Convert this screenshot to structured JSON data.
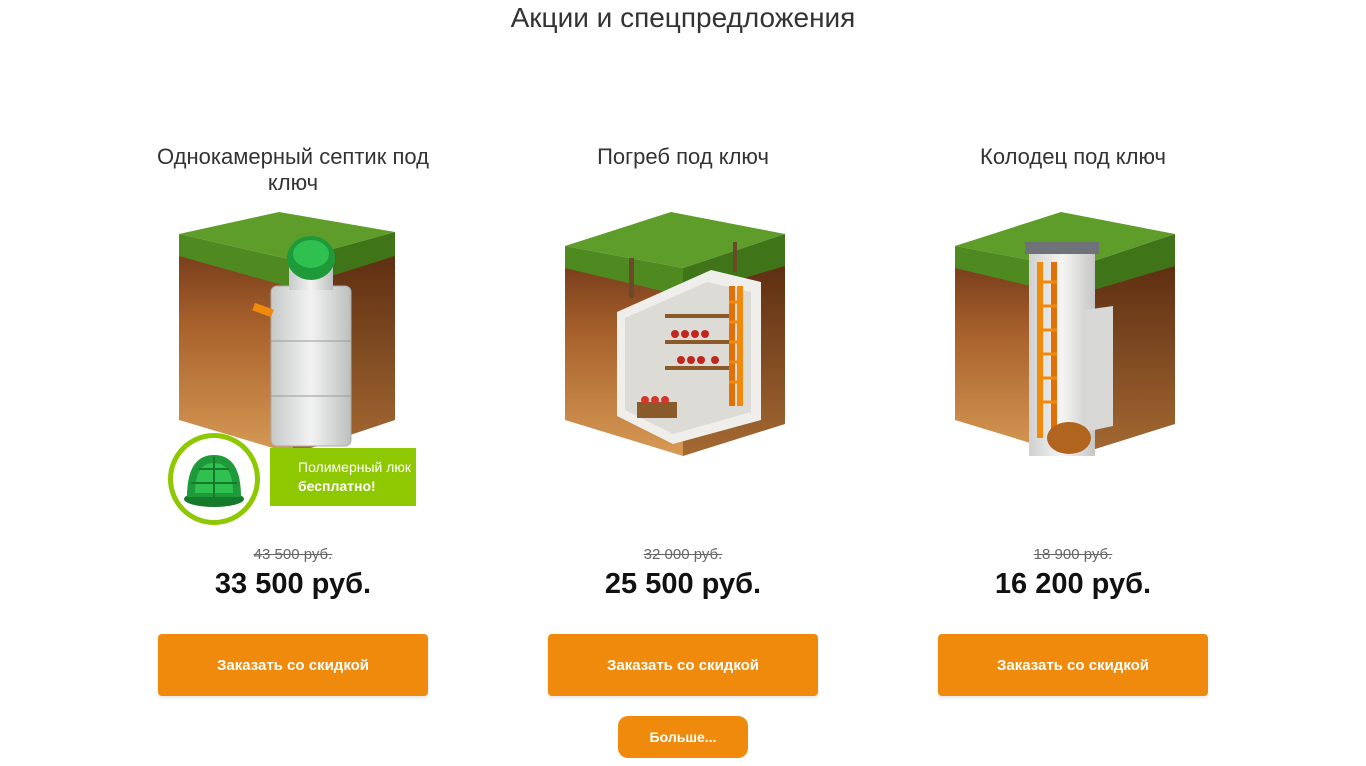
{
  "section": {
    "title": "Акции и спецпредложения"
  },
  "offers": [
    {
      "title": "Однокамерный септик под ключ",
      "image": "septic-tank-illustration",
      "promo": {
        "line1": "Полимерный люк",
        "line2": "бесплатно!",
        "icon": "polymer-hatch-icon"
      },
      "old_price": "43 500 руб.",
      "new_price": "33 500 руб.",
      "button_label": "Заказать со скидкой"
    },
    {
      "title": "Погреб под ключ",
      "image": "cellar-illustration",
      "old_price": "32 000 руб.",
      "new_price": "25 500 руб.",
      "button_label": "Заказать со скидкой"
    },
    {
      "title": "Колодец под ключ",
      "image": "well-illustration",
      "old_price": "18 900 руб.",
      "new_price": "16 200 руб.",
      "button_label": "Заказать со скидкой"
    }
  ],
  "more_button": {
    "label": "Больше..."
  },
  "colors": {
    "accent": "#f08a0c",
    "promo_green": "#8dc800",
    "grass": "#5f9d2a",
    "soil": "#b56a2e"
  }
}
